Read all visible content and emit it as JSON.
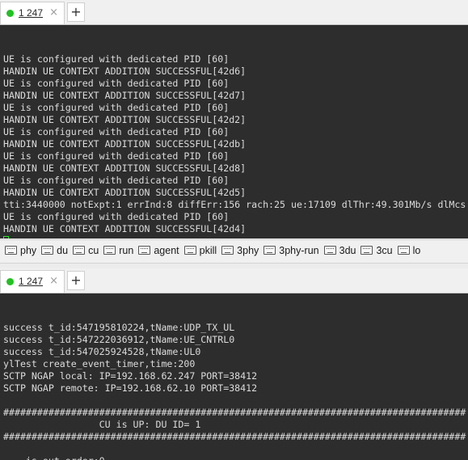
{
  "top_tab": {
    "label": "1 247",
    "close": "×",
    "new_tab": "+"
  },
  "top_terminal": {
    "lines": [
      "UE is configured with dedicated PID [60]",
      "HANDIN UE CONTEXT ADDITION SUCCESSFUL[42d6]",
      "UE is configured with dedicated PID [60]",
      "HANDIN UE CONTEXT ADDITION SUCCESSFUL[42d7]",
      "UE is configured with dedicated PID [60]",
      "HANDIN UE CONTEXT ADDITION SUCCESSFUL[42d2]",
      "UE is configured with dedicated PID [60]",
      "HANDIN UE CONTEXT ADDITION SUCCESSFUL[42db]",
      "UE is configured with dedicated PID [60]",
      "HANDIN UE CONTEXT ADDITION SUCCESSFUL[42d8]",
      "UE is configured with dedicated PID [60]",
      "HANDIN UE CONTEXT ADDITION SUCCESSFUL[42d5]",
      "tti:3440000 notExpt:1 errInd:8 diffErr:156 rach:25 ue:17109 dlThr:49.301Mb/s dlMcs",
      "UE is configured with dedicated PID [60]",
      "HANDIN UE CONTEXT ADDITION SUCCESSFUL[42d4]"
    ]
  },
  "quick_commands": [
    {
      "name": "phy",
      "label": "phy"
    },
    {
      "name": "du",
      "label": "du"
    },
    {
      "name": "cu",
      "label": "cu"
    },
    {
      "name": "run",
      "label": "run"
    },
    {
      "name": "agent",
      "label": "agent"
    },
    {
      "name": "pkill",
      "label": "pkill"
    },
    {
      "name": "3phy",
      "label": "3phy"
    },
    {
      "name": "3phy-run",
      "label": "3phy-run"
    },
    {
      "name": "3du",
      "label": "3du"
    },
    {
      "name": "3cu",
      "label": "3cu"
    },
    {
      "name": "lo",
      "label": "lo"
    }
  ],
  "bottom_tab": {
    "label": "1 247",
    "close": "×",
    "new_tab": "+"
  },
  "bottom_terminal": {
    "lines": [
      "success t_id:547195810224,tName:UDP_TX_UL",
      "success t_id:547222036912,tName:UE_CNTRL0",
      "success t_id:547025924528,tName:UL0",
      "ylTest create_event_timer,time:200",
      "SCTP NGAP local: IP=192.168.62.247 PORT=38412",
      "SCTP NGAP remote: IP=192.168.62.10 PORT=38412",
      "",
      "##################################################################################",
      "                 CU is UP: DU ID= 1",
      "##################################################################################",
      "",
      "----is_out_order:0"
    ]
  },
  "colors": {
    "terminal_bg": "#2d2d2d",
    "cursor": "#2ee62e",
    "status_dot": "#22c122"
  }
}
